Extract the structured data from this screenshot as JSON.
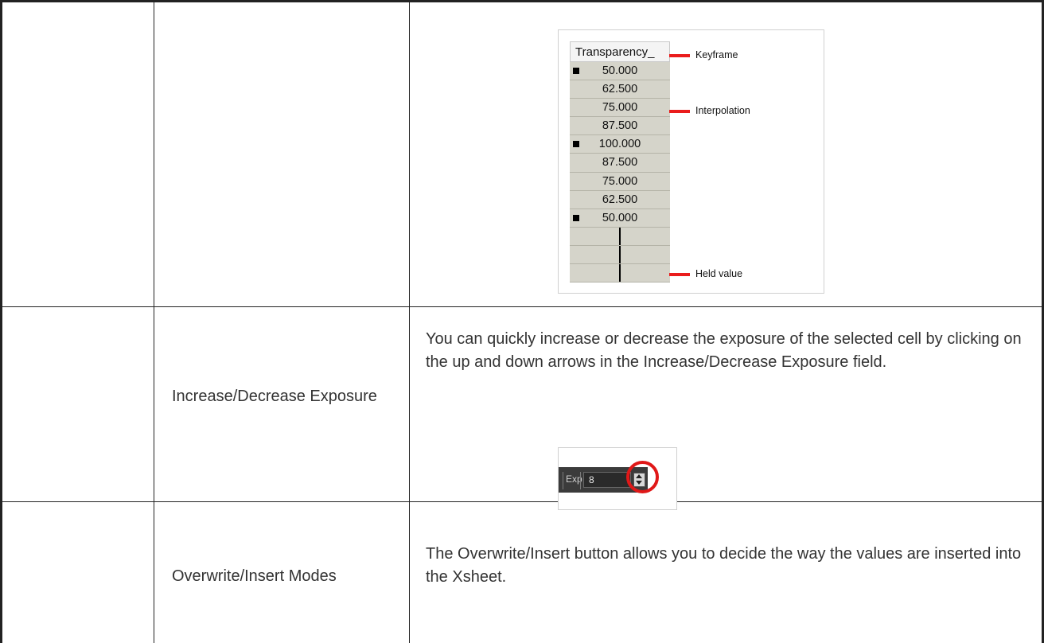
{
  "transparency_column": {
    "header": "Transparency_",
    "cells": [
      {
        "value": "50.000",
        "keyframe": true
      },
      {
        "value": "62.500",
        "keyframe": false
      },
      {
        "value": "75.000",
        "keyframe": false
      },
      {
        "value": "87.500",
        "keyframe": false
      },
      {
        "value": "100.000",
        "keyframe": true
      },
      {
        "value": "87.500",
        "keyframe": false
      },
      {
        "value": "75.000",
        "keyframe": false
      },
      {
        "value": "62.500",
        "keyframe": false
      },
      {
        "value": "50.000",
        "keyframe": true
      },
      {
        "value": "",
        "keyframe": false
      },
      {
        "value": "",
        "keyframe": false
      },
      {
        "value": "",
        "keyframe": false
      }
    ],
    "callouts": {
      "keyframe": "Keyframe",
      "interpolation": "Interpolation",
      "held_value": "Held value"
    },
    "callout_color": "#ea1c1c"
  },
  "rows": [
    {
      "name": "",
      "description": ""
    },
    {
      "name": "Increase/Decrease Exposure",
      "description": "You can quickly increase or decrease the exposure of the selected cell by clicking on the up and down arrows in the Increase/Decrease Exposure field."
    },
    {
      "name": "Overwrite/Insert Modes",
      "description": "The Overwrite/Insert button allows you to decide the way the values are inserted into the Xsheet."
    }
  ],
  "exposure_widget": {
    "label": "Exp",
    "value": "8",
    "highlight_color": "#e01818"
  }
}
